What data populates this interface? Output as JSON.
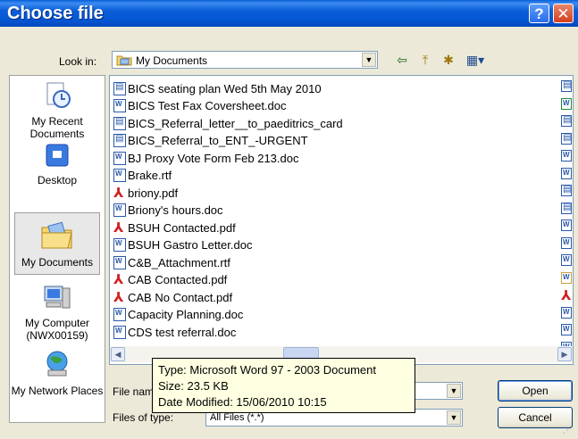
{
  "window": {
    "title": "Choose file",
    "help": "?",
    "close": "✕"
  },
  "lookin": {
    "label": "Look in:",
    "value": "My Documents"
  },
  "toolbar": {
    "back": "⇦",
    "up": "⤒",
    "new_folder": "✱",
    "view": "▦▾"
  },
  "places": [
    {
      "label": "My Recent Documents",
      "icon": "recent-documents-icon"
    },
    {
      "label": "Desktop",
      "icon": "desktop-icon"
    },
    {
      "label": "My Documents",
      "icon": "my-documents-icon"
    },
    {
      "label": "My Computer (NWX00159)",
      "icon": "my-computer-icon"
    },
    {
      "label": "My Network Places",
      "icon": "network-places-icon"
    }
  ],
  "files": [
    {
      "name": "BICS seating plan Wed 5th May 2010",
      "type": "pub"
    },
    {
      "name": "BICS Test Fax Coversheet.doc",
      "type": "doc"
    },
    {
      "name": "BICS_Referral_letter__to_paeditrics_card",
      "type": "pub"
    },
    {
      "name": "BICS_Referral_to_ENT_-URGENT",
      "type": "pub"
    },
    {
      "name": "BJ Proxy Vote Form Feb 213.doc",
      "type": "doc"
    },
    {
      "name": "Brake.rtf",
      "type": "doc"
    },
    {
      "name": "briony.pdf",
      "type": "pdf"
    },
    {
      "name": "Briony's hours.doc",
      "type": "doc"
    },
    {
      "name": "BSUH Contacted.pdf",
      "type": "pdf"
    },
    {
      "name": "BSUH Gastro Letter.doc",
      "type": "doc"
    },
    {
      "name": "C&B_Attachment.rtf",
      "type": "doc"
    },
    {
      "name": "CAB Contacted.pdf",
      "type": "pdf"
    },
    {
      "name": "CAB No Contact.pdf",
      "type": "pdf"
    },
    {
      "name": "Capacity Planning.doc",
      "type": "doc"
    },
    {
      "name": "CDS test referral.doc",
      "type": "doc"
    }
  ],
  "right_column_icons": [
    "pub",
    "xls",
    "pub",
    "pub",
    "doc",
    "doc",
    "pub",
    "pub",
    "doc",
    "doc",
    "doc",
    "img",
    "pdf",
    "doc",
    "doc",
    "doc"
  ],
  "filename": {
    "label": "File nam",
    "value": ""
  },
  "filetype": {
    "label": "Files of type:",
    "value": "All Files (*.*)"
  },
  "buttons": {
    "open": "Open",
    "cancel": "Cancel"
  },
  "tooltip": {
    "type": "Type: Microsoft Word 97 - 2003 Document",
    "size": "Size: 23.5 KB",
    "modified": "Date Modified: 15/06/2010 10:15"
  },
  "colors": {
    "titlebar": "#0a5ed8",
    "dialog": "#ece9d8",
    "tooltip": "#ffffe1"
  }
}
